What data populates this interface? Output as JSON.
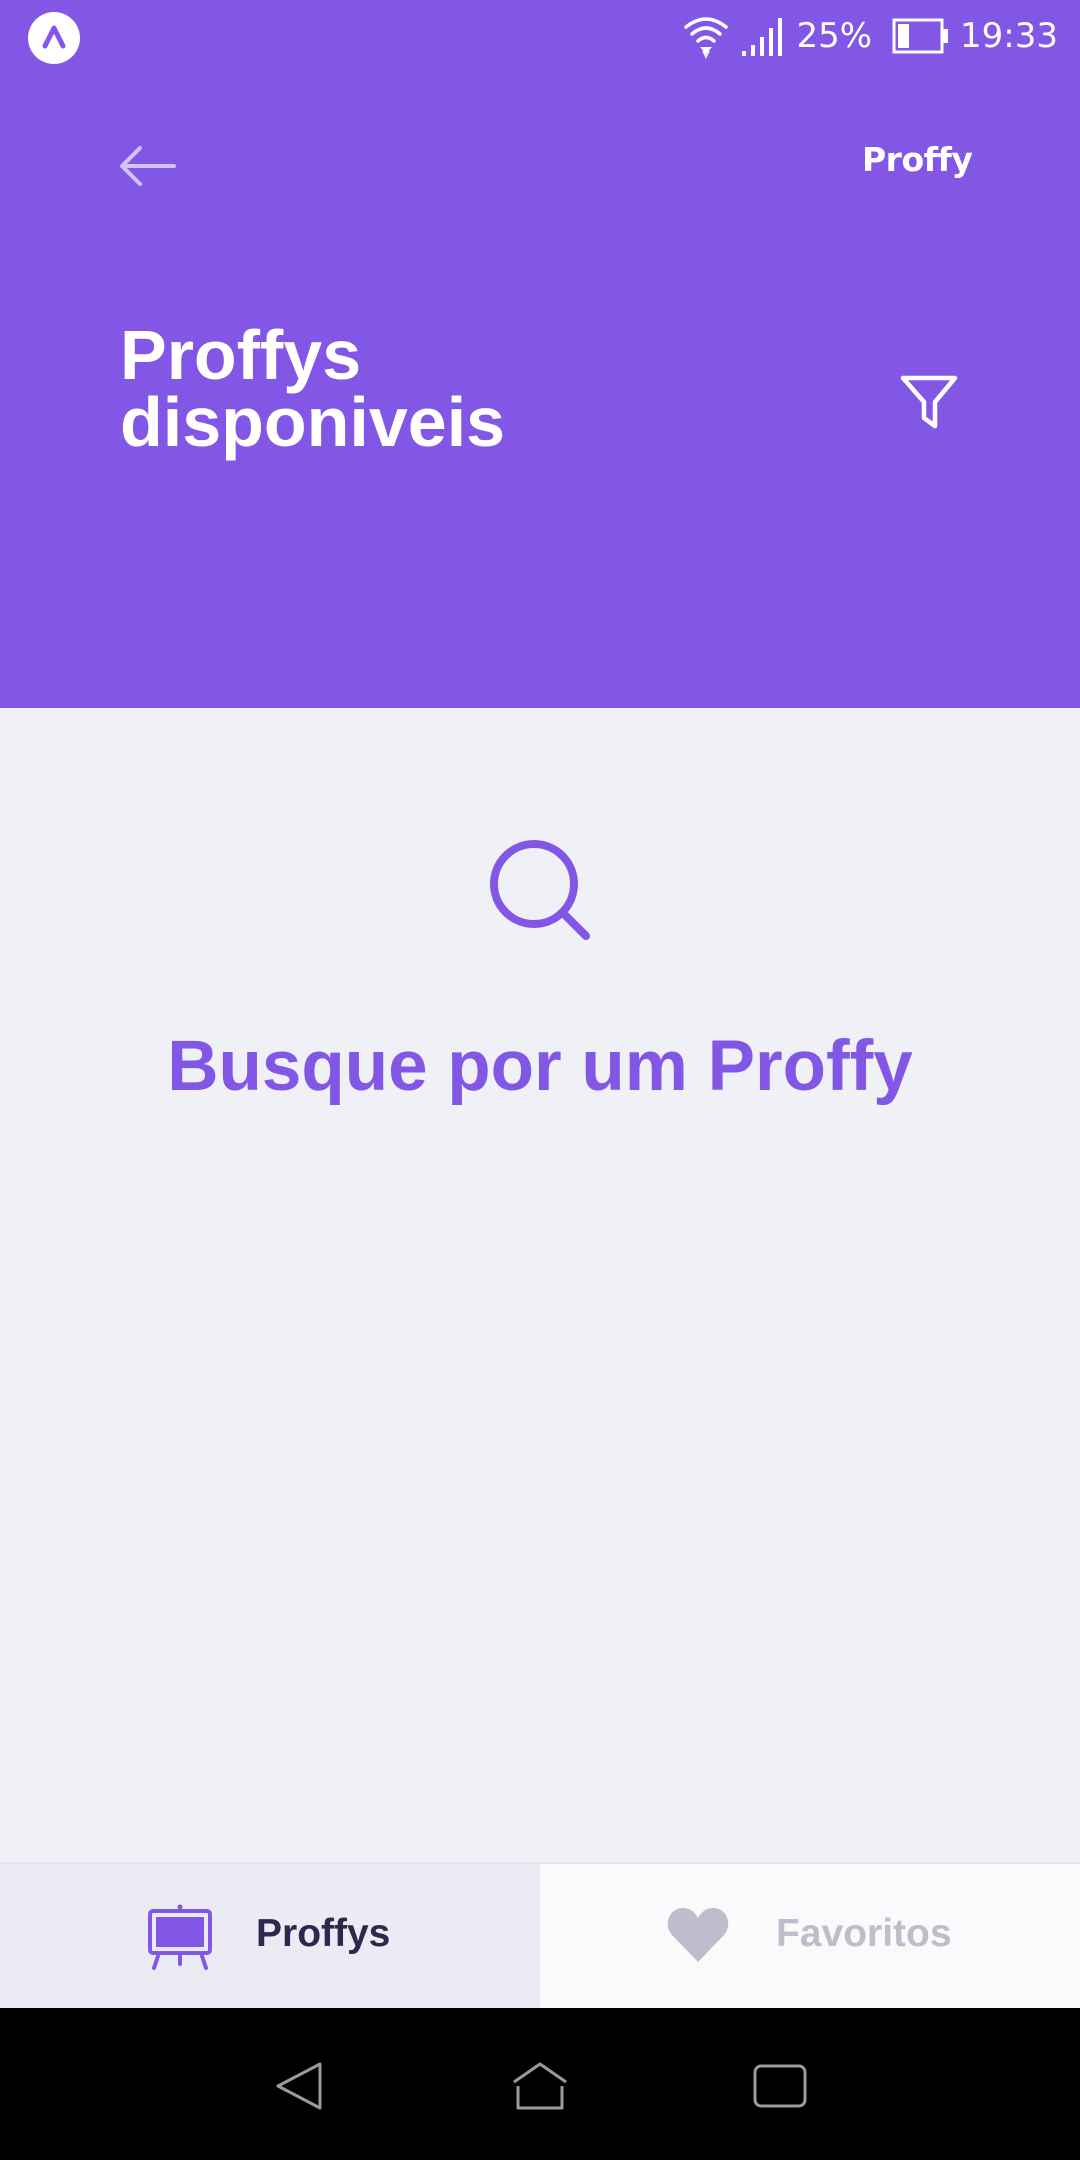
{
  "status_bar": {
    "battery_percent": "25%",
    "time": "19:33"
  },
  "header": {
    "logo_text": "Proffy",
    "title_line1": "Proffys",
    "title_line2": "disponiveis"
  },
  "main": {
    "empty_message": "Busque por um Proffy"
  },
  "tabs": [
    {
      "label": "Proffys",
      "icon": "easel-icon",
      "active": true
    },
    {
      "label": "Favoritos",
      "icon": "heart-icon",
      "active": false
    }
  ],
  "colors": {
    "primary": "#8257e5",
    "background": "#f0f0f7",
    "tab_active_text": "#32264d",
    "tab_inactive_text": "#c1bccc"
  }
}
